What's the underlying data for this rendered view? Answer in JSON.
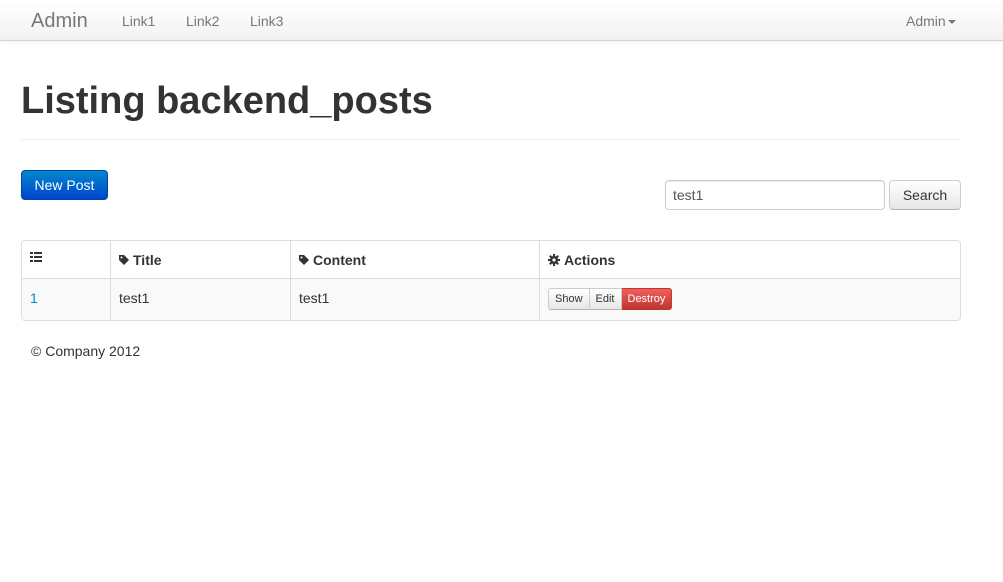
{
  "navbar": {
    "brand": "Admin",
    "links": [
      "Link1",
      "Link2",
      "Link3"
    ],
    "user_menu": "Admin"
  },
  "page": {
    "title": "Listing backend_posts"
  },
  "toolbar": {
    "new_post_label": "New Post",
    "search_value": "test1",
    "search_button_label": "Search"
  },
  "table": {
    "headers": [
      "",
      "Title",
      "Content",
      "Actions"
    ],
    "header_icons": [
      "list-icon",
      "tag-icon",
      "tag-icon",
      "cog-icon"
    ],
    "rows": [
      {
        "id": "1",
        "title": "test1",
        "content": "test1",
        "actions": [
          "Show",
          "Edit",
          "Destroy"
        ]
      }
    ]
  },
  "footer": {
    "text": "© Company 2012"
  },
  "colors": {
    "primary": "#0088cc",
    "danger": "#da4f49",
    "link": "#0088cc"
  }
}
